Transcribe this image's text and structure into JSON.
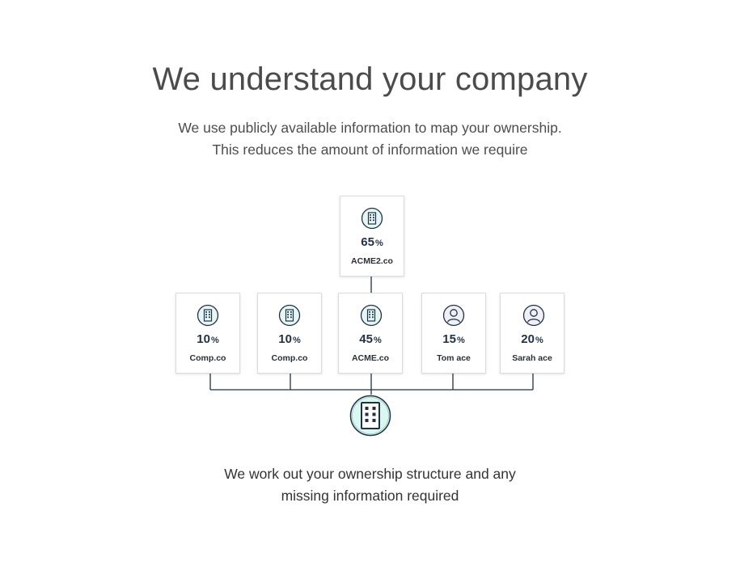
{
  "header": {
    "title": "We understand your company",
    "subtitle_line1": "We use publicly available information to map your ownership.",
    "subtitle_line2": "This reduces the amount of information we require"
  },
  "diagram": {
    "parent": {
      "percent": "65",
      "symbol": "%",
      "name": "ACME2.co",
      "icon": "building-icon"
    },
    "owners": [
      {
        "percent": "10",
        "symbol": "%",
        "name": "Comp.co",
        "icon": "building-icon"
      },
      {
        "percent": "10",
        "symbol": "%",
        "name": "Comp.co",
        "icon": "building-icon"
      },
      {
        "percent": "45",
        "symbol": "%",
        "name": "ACME.co",
        "icon": "building-icon"
      },
      {
        "percent": "15",
        "symbol": "%",
        "name": "Tom ace",
        "icon": "person-icon"
      },
      {
        "percent": "20",
        "symbol": "%",
        "name": "Sarah ace",
        "icon": "person-icon"
      }
    ],
    "hub_icon": "building-icon"
  },
  "footer": {
    "line1": "We work out your ownership structure and any",
    "line2": "missing information required"
  },
  "colors": {
    "icon_fill": "#e6f7f3",
    "icon_stroke": "#1f3148",
    "hub_fill": "#d9f8ef",
    "line": "#1f3148",
    "text_dark": "#1f3148"
  }
}
